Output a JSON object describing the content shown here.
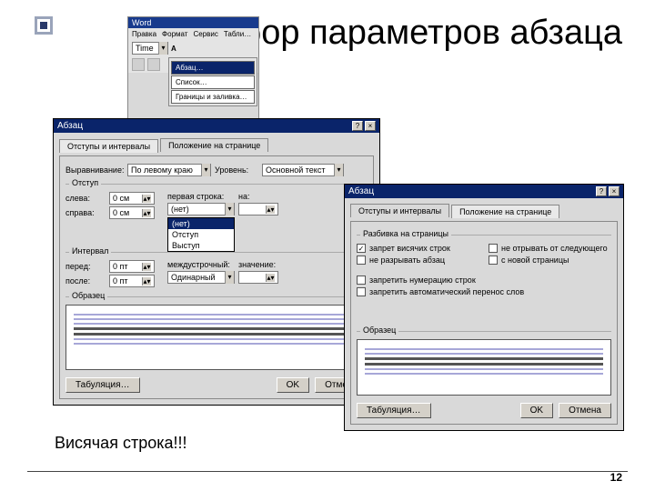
{
  "slide": {
    "title": "Выбор параметров абзаца",
    "caption": "Висячая строка!!!",
    "page_number": "12"
  },
  "word": {
    "title": "Word",
    "menu": [
      "Правка",
      "Формат",
      "Сервис",
      "Табли…"
    ],
    "font_sel": "Time",
    "dropdown_items": [
      "Абзац…",
      "Список…",
      "Границы и заливка…"
    ]
  },
  "dlg1": {
    "title": "Абзац",
    "tabs": [
      "Отступы и интервалы",
      "Положение на странице"
    ],
    "active_tab": 0,
    "align_label": "Выравнивание:",
    "align_value": "По левому краю",
    "level_label": "Уровень:",
    "level_value": "Основной текст",
    "indent_group": "Отступ",
    "left_label": "слева:",
    "left_value": "0 см",
    "right_label": "справа:",
    "right_value": "0 см",
    "firstline_label": "первая строка:",
    "firstline_on_label": "на:",
    "firstline_sel": "(нет)",
    "firstline_options": [
      "(нет)",
      "Отступ",
      "Выступ"
    ],
    "spacing_group": "Интервал",
    "before_label": "перед:",
    "before_value": "0 пт",
    "after_label": "после:",
    "after_value": "0 пт",
    "linesp_label": "междустрочный:",
    "linesp_sel": "Одинарный",
    "linesp_on_label": "значение:",
    "preview_label": "Образец",
    "tabstops": "Табуляция…",
    "ok": "OK",
    "cancel": "Отмена"
  },
  "dlg2": {
    "title": "Абзац",
    "tabs": [
      "Отступы и интервалы",
      "Положение на странице"
    ],
    "active_tab": 1,
    "group1": "Разбивка на страницы",
    "chk1": "запрет висячих строк",
    "chk2": "не разрывать абзац",
    "chk3": "не отрывать от следующего",
    "chk4": "с новой страницы",
    "chk5": "запретить нумерацию строк",
    "chk6": "запретить автоматический перенос слов",
    "preview_label": "Образец",
    "tabstops": "Табуляция…",
    "ok": "OK",
    "cancel": "Отмена"
  }
}
